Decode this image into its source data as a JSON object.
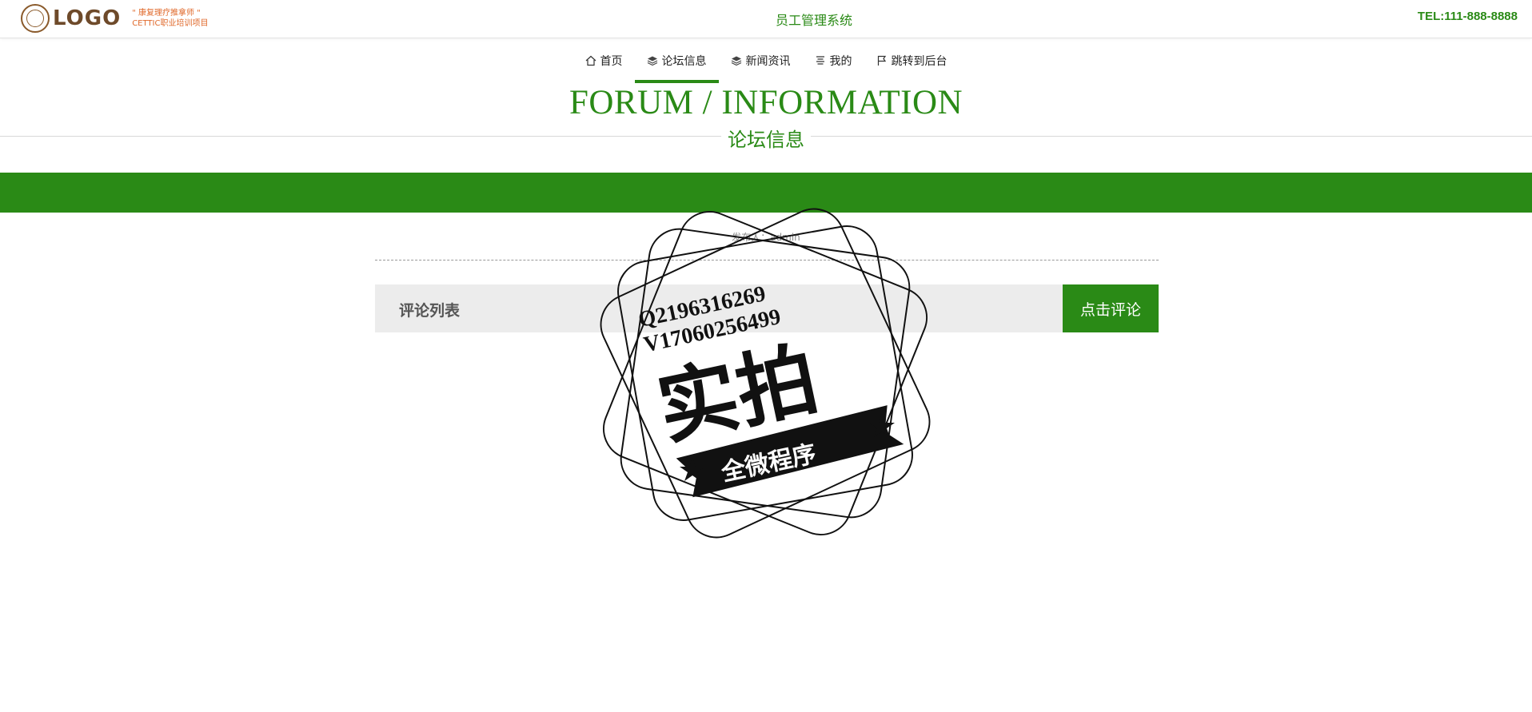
{
  "header": {
    "logo_text": "LOGO",
    "logo_sub_line1": "\" 康复理疗推拿师 \"",
    "logo_sub_line2": "CETTIC职业培训项目",
    "system_title": "员工管理系统",
    "tel": "TEL:111-888-8888"
  },
  "nav": {
    "items": [
      {
        "label": "首页",
        "icon": "home-icon"
      },
      {
        "label": "论坛信息",
        "icon": "layers-icon"
      },
      {
        "label": "新闻资讯",
        "icon": "layers-icon"
      },
      {
        "label": "我的",
        "icon": "list-icon"
      },
      {
        "label": "跳转到后台",
        "icon": "flag-icon"
      }
    ],
    "active_index": 1
  },
  "heading": {
    "english": "FORUM / INFORMATION",
    "chinese": "论坛信息"
  },
  "info": {
    "crumb": "发布人：admin"
  },
  "comments": {
    "title": "评论列表",
    "button_label": "点击评论"
  },
  "watermark": {
    "line1": "Q2196316269",
    "line2": "V17060256499",
    "big_text": "实拍",
    "ribbon_text": "全微程序"
  },
  "colors": {
    "accent": "#2a8a16",
    "logo_brown": "#6e4a2a",
    "logo_orange": "#e06a2c"
  }
}
